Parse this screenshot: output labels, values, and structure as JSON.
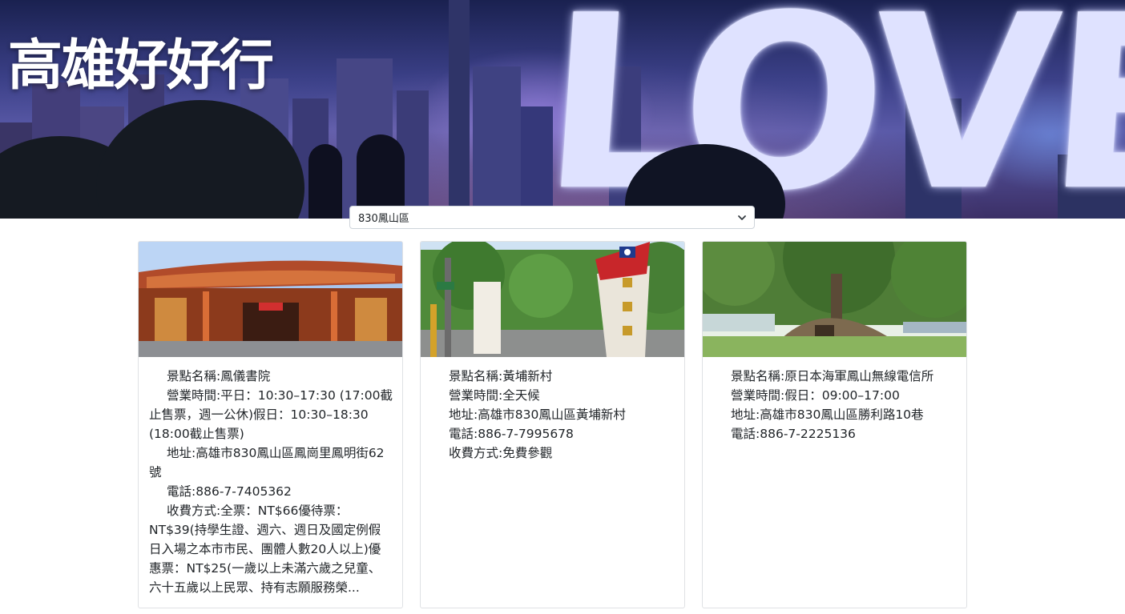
{
  "hero": {
    "title": "高雄好好行",
    "sign_text": "LOVE"
  },
  "district": {
    "selected": "830鳳山區"
  },
  "labels": {
    "name": "景點名稱:",
    "hours": "營業時間:",
    "address": "地址:",
    "phone": "電話:",
    "fee": "收費方式:"
  },
  "cards": [
    {
      "photo": "temple-photo",
      "name": "鳳儀書院",
      "hours": "平日：10:30–17:30 (17:00截止售票，週一公休)假日：10:30–18:30 (18:00截止售票)",
      "address": "高雄市830鳳山區鳳崗里鳳明街62號",
      "phone": "886-7-7405362",
      "fee": "全票：NT$66優待票：NT$39(持學生證、週六、週日及國定例假日入場之本市市民、團體人數20人以上)優惠票：NT$25(一歲以上未滿六歲之兒童、六十五歲以上民眾、持有志願服務榮..."
    },
    {
      "photo": "village-gate-photo",
      "name": "黃埔新村",
      "hours": "全天候",
      "address": "高雄市830鳳山區黃埔新村",
      "phone": "886-7-7995678",
      "fee": "免費參觀"
    },
    {
      "photo": "banyan-bunker-photo",
      "name": "原日本海軍鳳山無線電信所",
      "hours": "假日：09:00–17:00",
      "address": "高雄市830鳳山區勝利路10巷",
      "phone": "886-7-2225136"
    }
  ]
}
